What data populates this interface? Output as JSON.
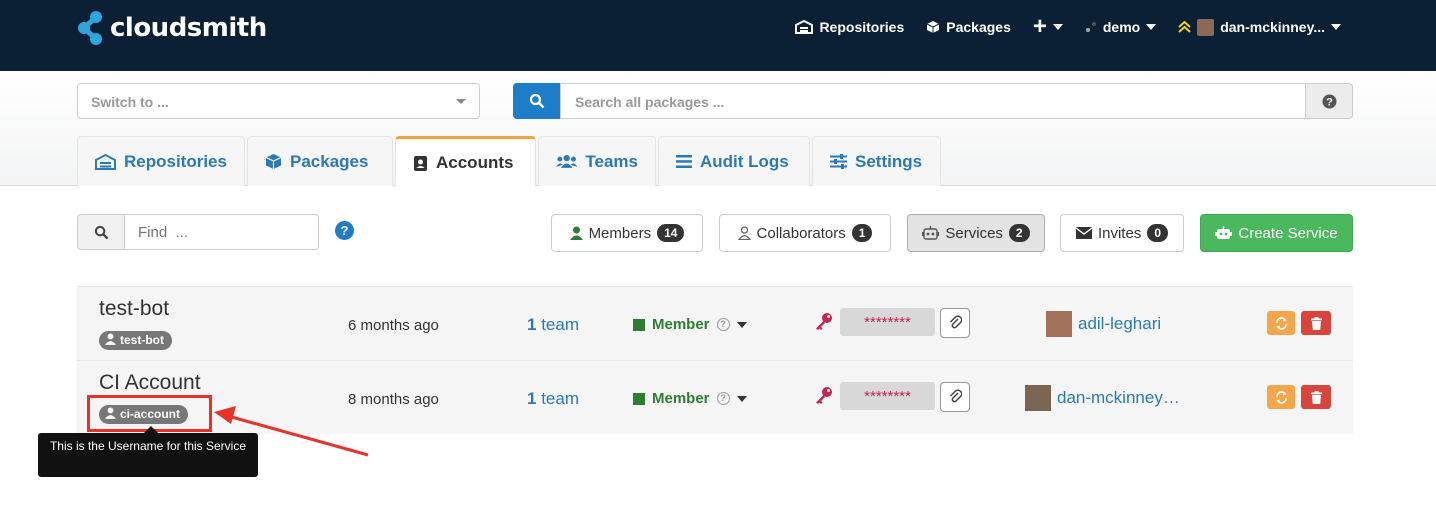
{
  "brand": {
    "name": "cloudsmith"
  },
  "topnav": {
    "repositories": "Repositories",
    "packages": "Packages",
    "plus": "+",
    "org": "demo",
    "user": "dan-mckinney..."
  },
  "switcher": {
    "placeholder": "Switch to ..."
  },
  "search": {
    "placeholder": "Search all packages ..."
  },
  "tabs": [
    {
      "label": "Repositories"
    },
    {
      "label": "Packages"
    },
    {
      "label": "Accounts"
    },
    {
      "label": "Teams"
    },
    {
      "label": "Audit Logs"
    },
    {
      "label": "Settings"
    }
  ],
  "find": {
    "placeholder": "Find  ..."
  },
  "filters": {
    "members": {
      "label": "Members",
      "count": "14"
    },
    "collaborators": {
      "label": "Collaborators",
      "count": "1"
    },
    "services": {
      "label": "Services",
      "count": "2"
    },
    "invites": {
      "label": "Invites",
      "count": "0"
    }
  },
  "create_service": "Create Service",
  "rows": [
    {
      "name": "test-bot",
      "username": "test-bot",
      "ago": "6 months ago",
      "team_count": "1",
      "team_word": "team",
      "role": "Member",
      "secret": "********",
      "owner": "adil-leghari"
    },
    {
      "name": "CI Account",
      "username": "ci-account",
      "ago": "8 months ago",
      "team_count": "1",
      "team_word": "team",
      "role": "Member",
      "secret": "********",
      "owner": "dan-mckinney…"
    }
  ],
  "annotation": {
    "tooltip": "This is the Username for this Service"
  },
  "colors": {
    "navbar": "#0b2035",
    "link": "#2a7ab8",
    "member_green": "#2e7d32",
    "create_green": "#4ab85c",
    "annotation_red": "#e8322a"
  }
}
